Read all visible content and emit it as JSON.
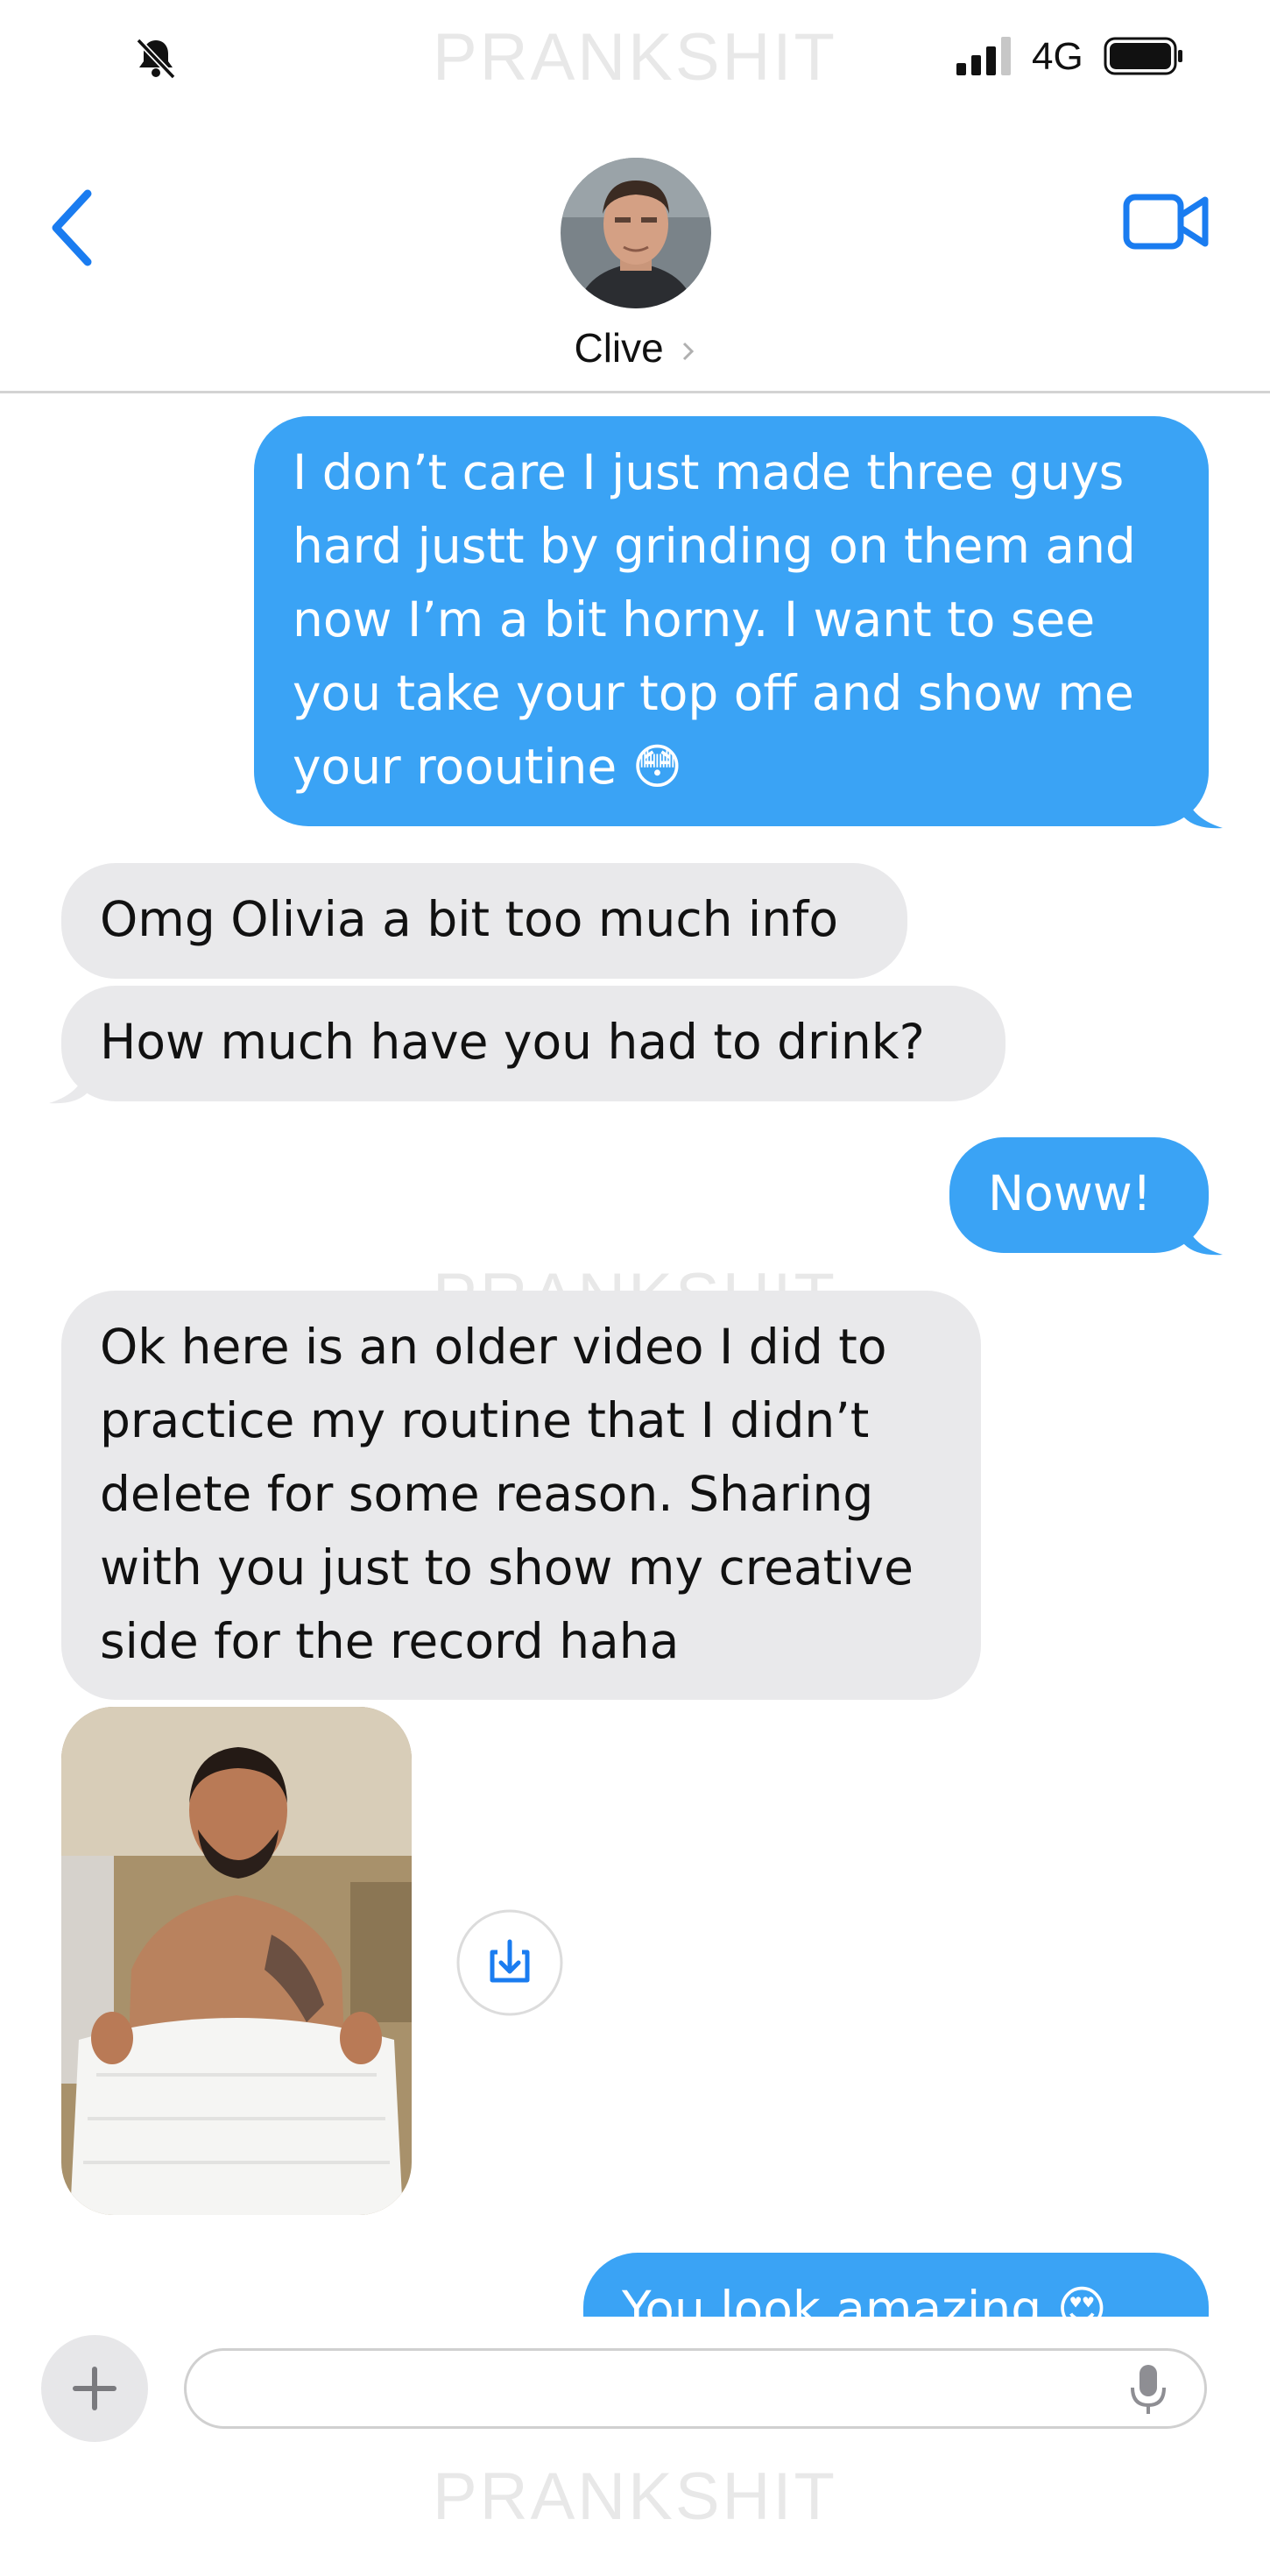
{
  "status_bar": {
    "watermark": "PRANKSHIT",
    "network": "4G"
  },
  "header": {
    "contact_name": "Clive"
  },
  "watermark": "PRANKSHIT",
  "messages": [
    {
      "direction": "outgoing",
      "text": "I don’t care I just made three guys\nhard justt by grinding on them and\nnow I’m a bit horny. I want to see\nyou take your top off and show me\nyour rooutine 😳"
    },
    {
      "direction": "incoming",
      "text": "Omg Olivia a bit too much info"
    },
    {
      "direction": "incoming",
      "text": "How much have you had to drink?"
    },
    {
      "direction": "outgoing",
      "text": "Noww!"
    },
    {
      "direction": "incoming",
      "text": "Ok here is an older video I did to\npractice my routine that I didn’t\ndelete for some reason. Sharing\nwith you just to show my creative\nside for the record haha"
    },
    {
      "direction": "incoming",
      "type": "video"
    },
    {
      "direction": "outgoing",
      "text": "You look amazing 😍"
    }
  ],
  "compose": {
    "placeholder": ""
  },
  "colors": {
    "accent": "#1a7cf0",
    "outgoing_bubble": "#3aa3f5",
    "incoming_bubble": "#e9e9eb"
  },
  "icons": [
    "bell-slash-icon",
    "signal-icon",
    "battery-icon",
    "back-chevron-icon",
    "video-call-icon",
    "save-icon",
    "plus-icon",
    "microphone-icon"
  ]
}
